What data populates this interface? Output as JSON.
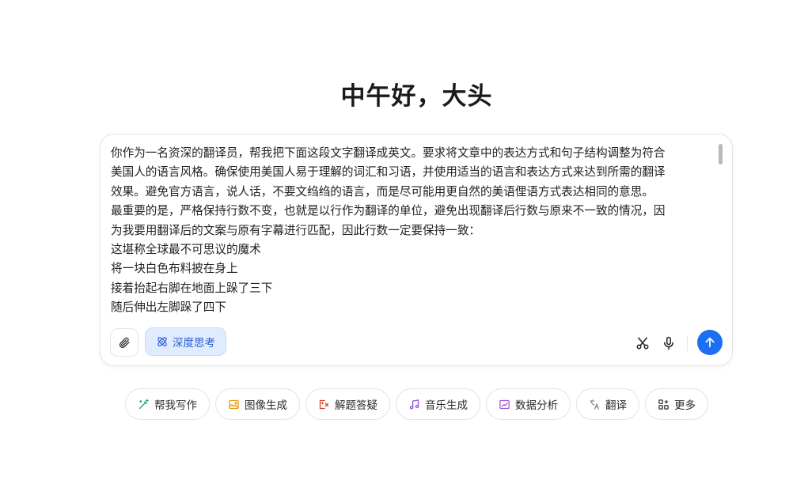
{
  "greeting": "中午好，大头",
  "input": {
    "lines": [
      "你作为一名资深的翻译员，帮我把下面这段文字翻译成英文。要求将文章中的表达方式和句子结构调整为符合",
      "美国人的语言风格。确保使用美国人易于理解的词汇和习语，并使用适当的语言和表达方式来达到所需的翻译",
      "效果。避免官方语言，说人话，不要文绉绉的语言，而是尽可能用更自然的美语俚语方式表达相同的意思。",
      "最重要的是，严格保持行数不变，也就是以行作为翻译的单位，避免出现翻译后行数与原来不一致的情况，因",
      "为我要用翻译后的文案与原有字幕进行匹配，因此行数一定要保持一致：",
      "这堪称全球最不可思议的魔术",
      "将一块白色布料披在身上",
      "接着抬起右脚在地面上跺了三下",
      "随后伸出左脚跺了四下"
    ]
  },
  "toolbar": {
    "deep_think_label": "深度思考"
  },
  "quick_actions": [
    {
      "label": "帮我写作",
      "icon": "pen-sparkle-icon",
      "color": "#22a35a"
    },
    {
      "label": "图像生成",
      "icon": "image-sparkle-icon",
      "color": "#e39b12"
    },
    {
      "label": "解题答疑",
      "icon": "formula-icon",
      "color": "#d9412f"
    },
    {
      "label": "音乐生成",
      "icon": "music-note-icon",
      "color": "#8a4fd8"
    },
    {
      "label": "数据分析",
      "icon": "chart-sparkle-icon",
      "color": "#9b5bd6"
    },
    {
      "label": "翻译",
      "icon": "translate-icon",
      "color": "#8a8f99"
    },
    {
      "label": "更多",
      "icon": "grid-plus-icon",
      "color": "#333333"
    }
  ],
  "colors": {
    "accent": "#1d6ff2",
    "deep_think_bg": "#e1ebfe",
    "deep_think_text": "#2a5fd6"
  }
}
